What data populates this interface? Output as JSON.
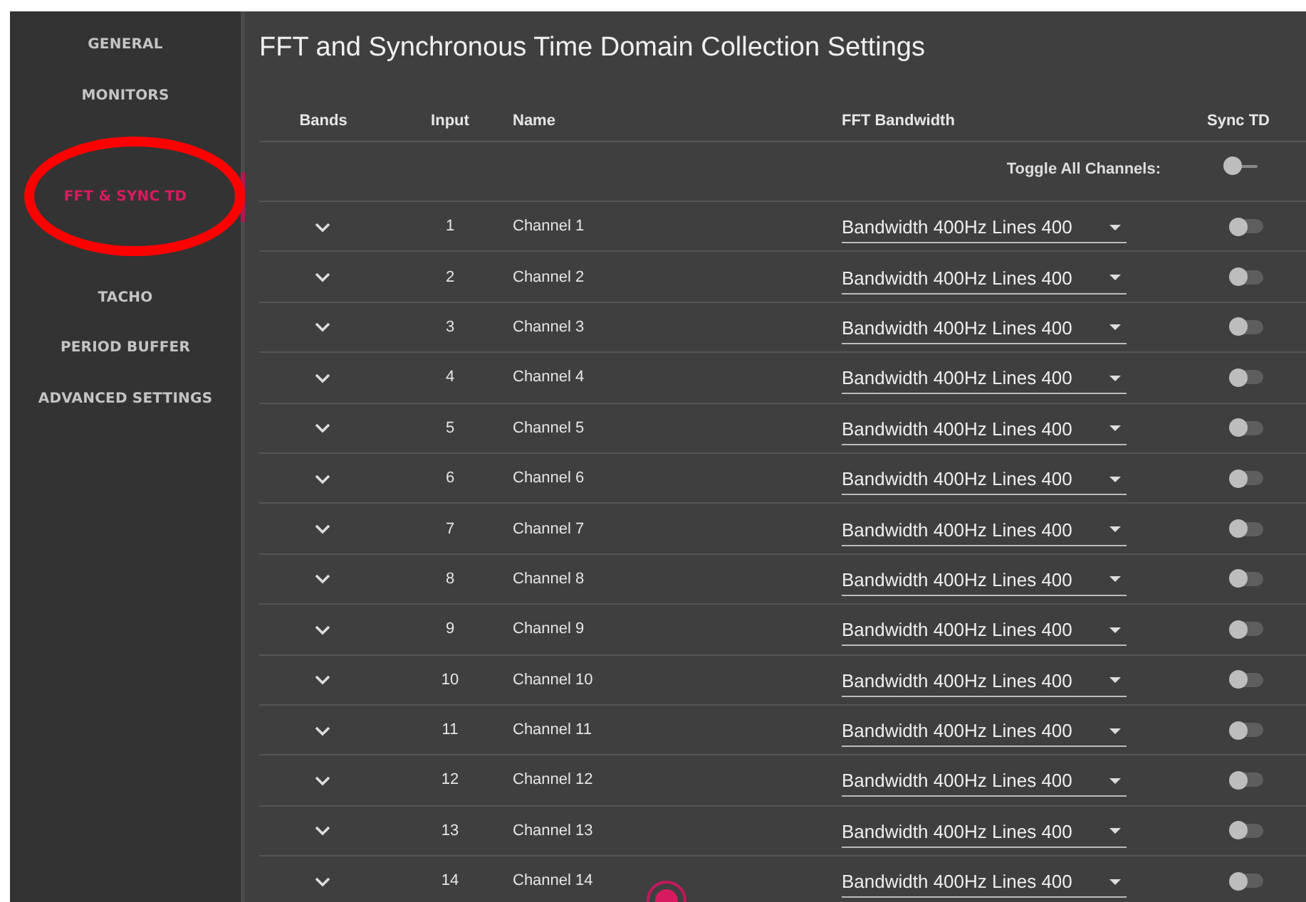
{
  "sidebar": {
    "items": [
      {
        "label": "GENERAL",
        "selected": false
      },
      {
        "label": "MONITORS",
        "selected": false
      },
      {
        "label": "FFT & SYNC TD",
        "selected": true
      },
      {
        "label": "TACHO",
        "selected": false
      },
      {
        "label": "PERIOD BUFFER",
        "selected": false
      },
      {
        "label": "ADVANCED SETTINGS",
        "selected": false
      }
    ]
  },
  "title": "FFT and Synchronous Time Domain Collection Settings",
  "table": {
    "columns": [
      "Bands",
      "Input",
      "Name",
      "FFT Bandwidth",
      "Sync TD"
    ],
    "toggle_all": {
      "label": "Toggle All Channels:",
      "on": false
    },
    "rows": [
      {
        "input": "1",
        "name": "Channel 1",
        "bandwidth": "Bandwidth 400Hz Lines 400",
        "sync_td": false
      },
      {
        "input": "2",
        "name": "Channel 2",
        "bandwidth": "Bandwidth 400Hz Lines 400",
        "sync_td": false
      },
      {
        "input": "3",
        "name": "Channel 3",
        "bandwidth": "Bandwidth 400Hz Lines 400",
        "sync_td": false
      },
      {
        "input": "4",
        "name": "Channel 4",
        "bandwidth": "Bandwidth 400Hz Lines 400",
        "sync_td": false
      },
      {
        "input": "5",
        "name": "Channel 5",
        "bandwidth": "Bandwidth 400Hz Lines 400",
        "sync_td": false
      },
      {
        "input": "6",
        "name": "Channel 6",
        "bandwidth": "Bandwidth 400Hz Lines 400",
        "sync_td": false
      },
      {
        "input": "7",
        "name": "Channel 7",
        "bandwidth": "Bandwidth 400Hz Lines 400",
        "sync_td": false
      },
      {
        "input": "8",
        "name": "Channel 8",
        "bandwidth": "Bandwidth 400Hz Lines 400",
        "sync_td": false
      },
      {
        "input": "9",
        "name": "Channel 9",
        "bandwidth": "Bandwidth 400Hz Lines 400",
        "sync_td": false
      },
      {
        "input": "10",
        "name": "Channel 10",
        "bandwidth": "Bandwidth 400Hz Lines 400",
        "sync_td": false
      },
      {
        "input": "11",
        "name": "Channel 11",
        "bandwidth": "Bandwidth 400Hz Lines 400",
        "sync_td": false
      },
      {
        "input": "12",
        "name": "Channel 12",
        "bandwidth": "Bandwidth 400Hz Lines 400",
        "sync_td": false
      },
      {
        "input": "13",
        "name": "Channel 13",
        "bandwidth": "Bandwidth 400Hz Lines 400",
        "sync_td": false
      },
      {
        "input": "14",
        "name": "Channel 14",
        "bandwidth": "Bandwidth 400Hz Lines 400",
        "sync_td": false
      }
    ]
  }
}
